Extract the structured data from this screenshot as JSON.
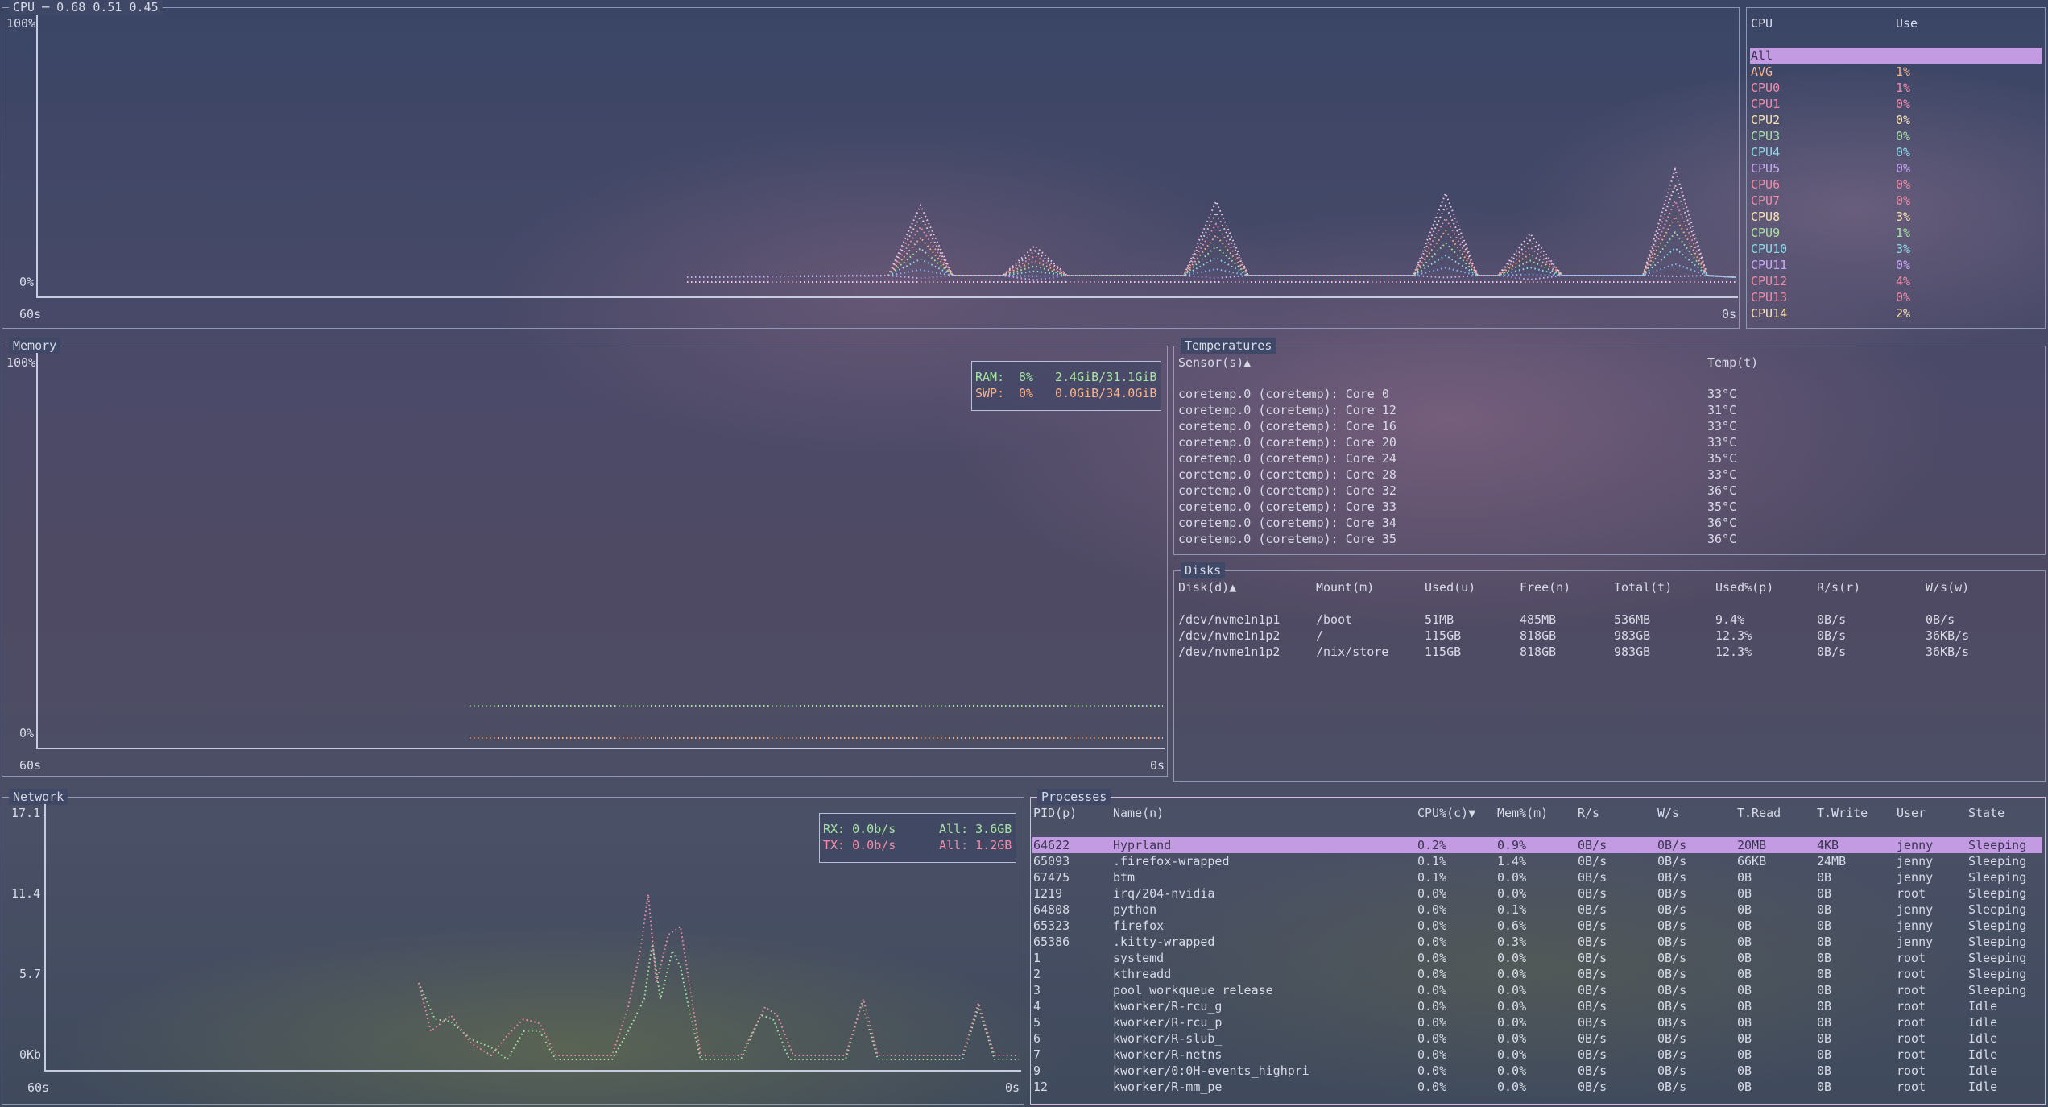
{
  "cpu_panel": {
    "title": "CPU ─ 0.68 0.51 0.45",
    "y_top": "100%",
    "y_bottom": "0%",
    "x_left": "60s",
    "x_right": "0s",
    "colors": [
      "#f5c2e7",
      "#f2cdcd",
      "#f38ba8",
      "#fab387",
      "#a6e3a1",
      "#89dceb",
      "#89b4fa",
      "#cba6f7"
    ]
  },
  "cpu_list": {
    "header_cpu": "CPU",
    "header_use": "Use",
    "rows": [
      {
        "name": "All",
        "use": "",
        "color": "#3a3550"
      },
      {
        "name": "AVG",
        "use": "1%",
        "color": "#fab387"
      },
      {
        "name": "CPU0",
        "use": "1%",
        "color": "#f38ba8"
      },
      {
        "name": "CPU1",
        "use": "0%",
        "color": "#f38ba8"
      },
      {
        "name": "CPU2",
        "use": "0%",
        "color": "#f9e2af"
      },
      {
        "name": "CPU3",
        "use": "0%",
        "color": "#a6e3a1"
      },
      {
        "name": "CPU4",
        "use": "0%",
        "color": "#89dceb"
      },
      {
        "name": "CPU5",
        "use": "0%",
        "color": "#cba6f7"
      },
      {
        "name": "CPU6",
        "use": "0%",
        "color": "#f38ba8"
      },
      {
        "name": "CPU7",
        "use": "0%",
        "color": "#f38ba8"
      },
      {
        "name": "CPU8",
        "use": "3%",
        "color": "#f9e2af"
      },
      {
        "name": "CPU9",
        "use": "1%",
        "color": "#a6e3a1"
      },
      {
        "name": "CPU10",
        "use": "3%",
        "color": "#89dceb"
      },
      {
        "name": "CPU11",
        "use": "0%",
        "color": "#cba6f7"
      },
      {
        "name": "CPU12",
        "use": "4%",
        "color": "#f38ba8"
      },
      {
        "name": "CPU13",
        "use": "0%",
        "color": "#f38ba8"
      },
      {
        "name": "CPU14",
        "use": "2%",
        "color": "#f9e2af"
      }
    ]
  },
  "memory": {
    "title": "Memory",
    "y_top": "100%",
    "y_bottom": "0%",
    "x_left": "60s",
    "x_right": "0s",
    "ram_label": "RAM:",
    "ram_pct": "8%",
    "ram_val": "2.4GiB/31.1GiB",
    "ram_color": "#a6e3a1",
    "ram_fraction": 0.08,
    "swp_label": "SWP:",
    "swp_pct": "0%",
    "swp_val": "0.0GiB/34.0GiB",
    "swp_color": "#fab387",
    "swp_fraction": 0.0
  },
  "temperatures": {
    "title": "Temperatures",
    "header_sensor": "Sensor(s)▲",
    "header_temp": "Temp(t)",
    "rows": [
      {
        "sensor": "coretemp.0 (coretemp): Core 0",
        "temp": "33°C"
      },
      {
        "sensor": "coretemp.0 (coretemp): Core 12",
        "temp": "31°C"
      },
      {
        "sensor": "coretemp.0 (coretemp): Core 16",
        "temp": "33°C"
      },
      {
        "sensor": "coretemp.0 (coretemp): Core 20",
        "temp": "33°C"
      },
      {
        "sensor": "coretemp.0 (coretemp): Core 24",
        "temp": "35°C"
      },
      {
        "sensor": "coretemp.0 (coretemp): Core 28",
        "temp": "33°C"
      },
      {
        "sensor": "coretemp.0 (coretemp): Core 32",
        "temp": "36°C"
      },
      {
        "sensor": "coretemp.0 (coretemp): Core 33",
        "temp": "35°C"
      },
      {
        "sensor": "coretemp.0 (coretemp): Core 34",
        "temp": "36°C"
      },
      {
        "sensor": "coretemp.0 (coretemp): Core 35",
        "temp": "36°C"
      }
    ]
  },
  "disks": {
    "title": "Disks",
    "headers": [
      "Disk(d)▲",
      "Mount(m)",
      "Used(u)",
      "Free(n)",
      "Total(t)",
      "Used%(p)",
      "R/s(r)",
      "W/s(w)"
    ],
    "rows": [
      [
        "/dev/nvme1n1p1",
        "/boot",
        "51MB",
        "485MB",
        "536MB",
        "9.4%",
        "0B/s",
        "0B/s"
      ],
      [
        "/dev/nvme1n1p2",
        "/",
        "115GB",
        "818GB",
        "983GB",
        "12.3%",
        "0B/s",
        "36KB/s"
      ],
      [
        "/dev/nvme1n1p2",
        "/nix/store",
        "115GB",
        "818GB",
        "983GB",
        "12.3%",
        "0B/s",
        "36KB/s"
      ]
    ]
  },
  "network": {
    "title": "Network",
    "y_ticks": [
      "17.1",
      "11.4",
      "5.7",
      "0Kb"
    ],
    "x_left": "60s",
    "x_right": "0s",
    "rx_label": "RX: 0.0b/s",
    "rx_all": "All: 3.6GB",
    "rx_color": "#a6e3a1",
    "tx_label": "TX: 0.0b/s",
    "tx_all": "All: 1.2GB",
    "tx_color": "#f38ba8"
  },
  "processes": {
    "title": "Processes",
    "headers": [
      "PID(p)",
      "Name(n)",
      "CPU%(c)▼",
      "Mem%(m)",
      "R/s",
      "W/s",
      "T.Read",
      "T.Write",
      "User",
      "State"
    ],
    "rows": [
      [
        "64622",
        "Hyprland",
        "0.2%",
        "0.9%",
        "0B/s",
        "0B/s",
        "20MB",
        "4KB",
        "jenny",
        "Sleeping"
      ],
      [
        "65093",
        ".firefox-wrapped",
        "0.1%",
        "1.4%",
        "0B/s",
        "0B/s",
        "66KB",
        "24MB",
        "jenny",
        "Sleeping"
      ],
      [
        "67475",
        "btm",
        "0.1%",
        "0.0%",
        "0B/s",
        "0B/s",
        "0B",
        "0B",
        "jenny",
        "Sleeping"
      ],
      [
        "1219",
        "irq/204-nvidia",
        "0.0%",
        "0.0%",
        "0B/s",
        "0B/s",
        "0B",
        "0B",
        "root",
        "Sleeping"
      ],
      [
        "64808",
        "python",
        "0.0%",
        "0.1%",
        "0B/s",
        "0B/s",
        "0B",
        "0B",
        "jenny",
        "Sleeping"
      ],
      [
        "65323",
        "firefox",
        "0.0%",
        "0.6%",
        "0B/s",
        "0B/s",
        "0B",
        "0B",
        "jenny",
        "Sleeping"
      ],
      [
        "65386",
        ".kitty-wrapped",
        "0.0%",
        "0.3%",
        "0B/s",
        "0B/s",
        "0B",
        "0B",
        "jenny",
        "Sleeping"
      ],
      [
        "1",
        "systemd",
        "0.0%",
        "0.0%",
        "0B/s",
        "0B/s",
        "0B",
        "0B",
        "root",
        "Sleeping"
      ],
      [
        "2",
        "kthreadd",
        "0.0%",
        "0.0%",
        "0B/s",
        "0B/s",
        "0B",
        "0B",
        "root",
        "Sleeping"
      ],
      [
        "3",
        "pool_workqueue_release",
        "0.0%",
        "0.0%",
        "0B/s",
        "0B/s",
        "0B",
        "0B",
        "root",
        "Sleeping"
      ],
      [
        "4",
        "kworker/R-rcu_g",
        "0.0%",
        "0.0%",
        "0B/s",
        "0B/s",
        "0B",
        "0B",
        "root",
        "Idle"
      ],
      [
        "5",
        "kworker/R-rcu_p",
        "0.0%",
        "0.0%",
        "0B/s",
        "0B/s",
        "0B",
        "0B",
        "root",
        "Idle"
      ],
      [
        "6",
        "kworker/R-slub_",
        "0.0%",
        "0.0%",
        "0B/s",
        "0B/s",
        "0B",
        "0B",
        "root",
        "Idle"
      ],
      [
        "7",
        "kworker/R-netns",
        "0.0%",
        "0.0%",
        "0B/s",
        "0B/s",
        "0B",
        "0B",
        "root",
        "Idle"
      ],
      [
        "9",
        "kworker/0:0H-events_highpri",
        "0.0%",
        "0.0%",
        "0B/s",
        "0B/s",
        "0B",
        "0B",
        "root",
        "Idle"
      ],
      [
        "12",
        "kworker/R-mm_pe",
        "0.0%",
        "0.0%",
        "0B/s",
        "0B/s",
        "0B",
        "0B",
        "root",
        "Idle"
      ]
    ]
  }
}
